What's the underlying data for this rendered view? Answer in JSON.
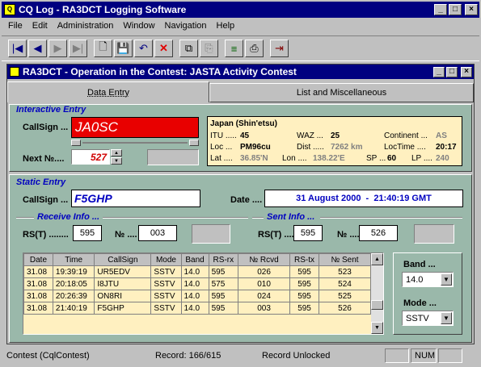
{
  "app": {
    "title": "CQ Log - RA3DCT Logging Software"
  },
  "menu": [
    "File",
    "Edit",
    "Administration",
    "Window",
    "Navigation",
    "Help"
  ],
  "window": {
    "title": "RA3DCT - Operation in the Contest: JASTA Activity Contest"
  },
  "tabs": [
    "Data Entry",
    "List and Miscellaneous"
  ],
  "interactive": {
    "section_label": "Interactive Entry",
    "callsign_label": "CallSign ...",
    "callsign_value": "JA0SC",
    "next_label": "Next №....",
    "next_value": "527"
  },
  "info": {
    "country": "Japan (Shin'etsu)",
    "itu_label": "ITU .....",
    "itu_value": "45",
    "waz_label": "WAZ ...",
    "waz_value": "25",
    "continent_label": "Continent ...",
    "continent_value": "AS",
    "loc_label": "Loc ...",
    "loc_value": "PM96cu",
    "dist_label": "Dist .....",
    "dist_value": "7262 km",
    "loctime_label": "LocTime ....",
    "loctime_value": "20:17",
    "lat_label": "Lat ....",
    "lat_value": "36.85'N",
    "lon_label": "Lon ....",
    "lon_value": "138.22'E",
    "sp_label": "SP ...",
    "sp_value": "60",
    "lp_label": "LP ....",
    "lp_value": "240"
  },
  "static": {
    "section_label": "Static Entry",
    "callsign_label": "CallSign ...",
    "callsign_value": "F5GHP",
    "date_label": "Date ....",
    "date_value": "31 August 2000  -  21:40:19 GMT",
    "receive_label": "Receive Info ...",
    "sent_label": "Sent Info ...",
    "rst_label": "RS(T) ........",
    "rst_value": "595",
    "nr_label": "№ ....",
    "nr_value": "003",
    "sent_rst_label": "RS(T) ....",
    "sent_rst_value": "595",
    "sent_nr_label": "№ ....",
    "sent_nr_value": "526"
  },
  "log_table": {
    "headers": [
      "Date",
      "Time",
      "CallSign",
      "Mode",
      "Band",
      "RS-rx",
      "№ Rcvd",
      "RS-tx",
      "№ Sent"
    ],
    "rows": [
      [
        "31.08",
        "19:39:19",
        "UR5EDV",
        "SSTV",
        "14.0",
        "595",
        "026",
        "595",
        "523"
      ],
      [
        "31.08",
        "20:18:05",
        "I8JTU",
        "SSTV",
        "14.0",
        "575",
        "010",
        "595",
        "524"
      ],
      [
        "31.08",
        "20:26:39",
        "ON8RI",
        "SSTV",
        "14.0",
        "595",
        "024",
        "595",
        "525"
      ],
      [
        "31.08",
        "21:40:19",
        "F5GHP",
        "SSTV",
        "14.0",
        "595",
        "003",
        "595",
        "526"
      ]
    ]
  },
  "band": {
    "label": "Band ...",
    "value": "14.0"
  },
  "mode": {
    "label": "Mode ...",
    "value": "SSTV"
  },
  "status": {
    "contest": "Contest (CqlContest)",
    "record": "Record: 166/615",
    "lock": "Record Unlocked",
    "num": "NUM"
  },
  "colors": {
    "title_bg": "#000080",
    "panel_bg": "#9ab8aa",
    "callsign_bg": "#e80000",
    "info_bg": "#fff0c0"
  }
}
